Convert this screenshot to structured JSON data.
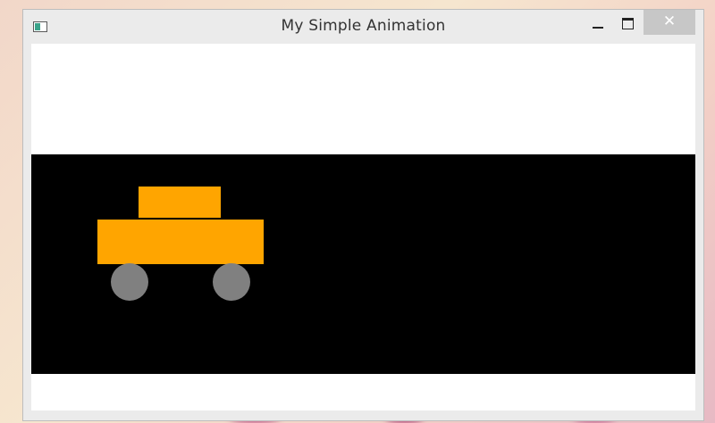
{
  "window": {
    "title": "My Simple Animation",
    "controls": {
      "minimize_icon": "minimize-icon",
      "maximize_icon": "maximize-icon",
      "close_glyph": "✕"
    }
  },
  "canvas": {
    "background_color": "#ffffff",
    "stage_color": "#000000",
    "car": {
      "body_color": "#ffa500",
      "cabin_color": "#ffa500",
      "wheel_color": "#808080"
    }
  }
}
